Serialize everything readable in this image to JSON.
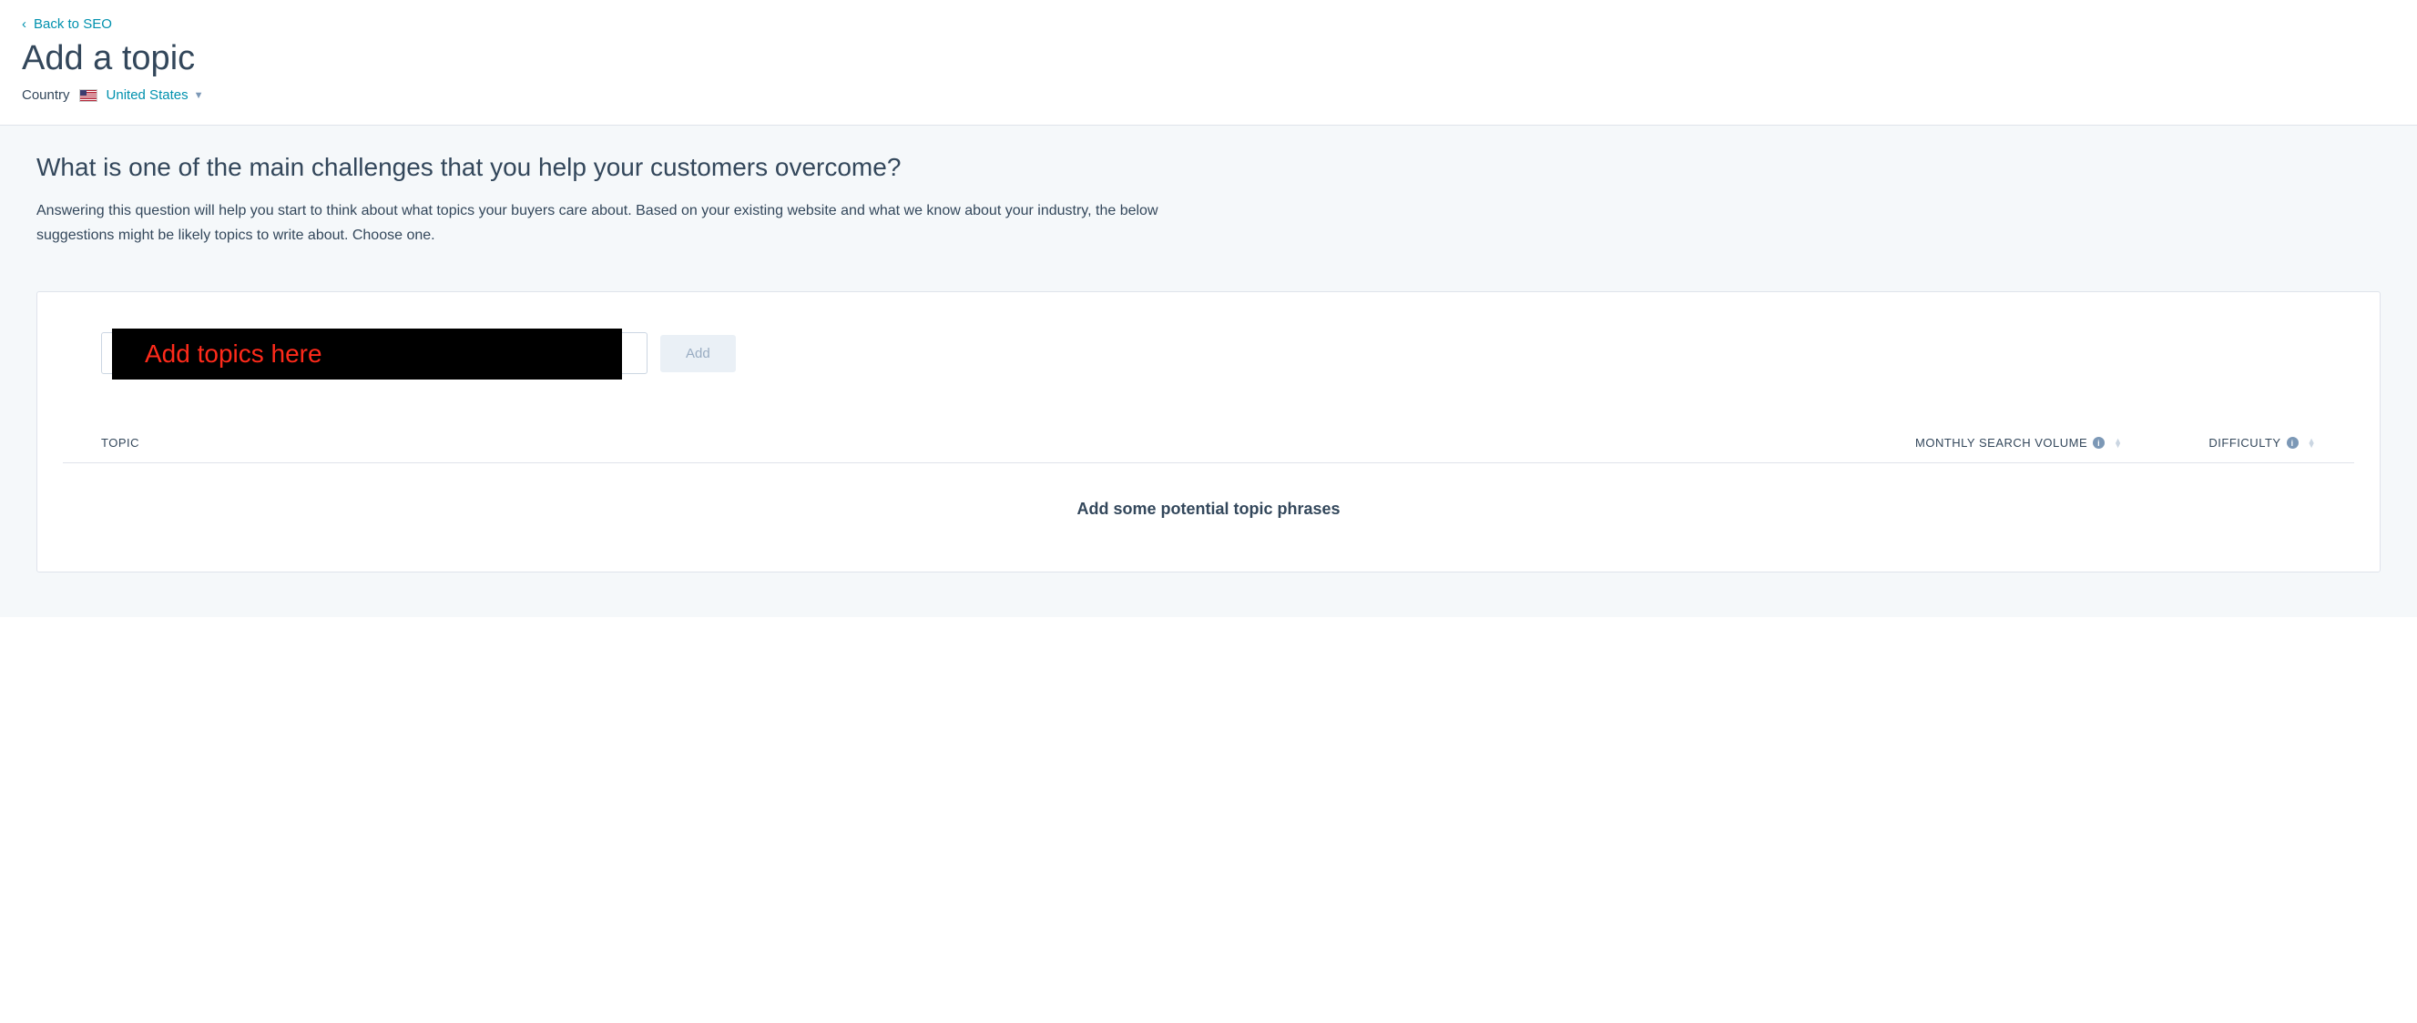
{
  "nav": {
    "back_label": "Back to SEO"
  },
  "page": {
    "title": "Add a topic"
  },
  "country": {
    "label": "Country",
    "selected": "United States"
  },
  "prompt": {
    "heading": "What is one of the main challenges that you help your customers overcome?",
    "description": "Answering this question will help you start to think about what topics your buyers care about. Based on your existing website and what we know about your industry, the below suggestions might be likely topics to write about. Choose one."
  },
  "input": {
    "add_button": "Add",
    "annotation_text": "Add topics here"
  },
  "table": {
    "columns": {
      "topic": "TOPIC",
      "msv": "MONTHLY SEARCH VOLUME",
      "difficulty": "DIFFICULTY"
    },
    "empty_message": "Add some potential topic phrases"
  }
}
